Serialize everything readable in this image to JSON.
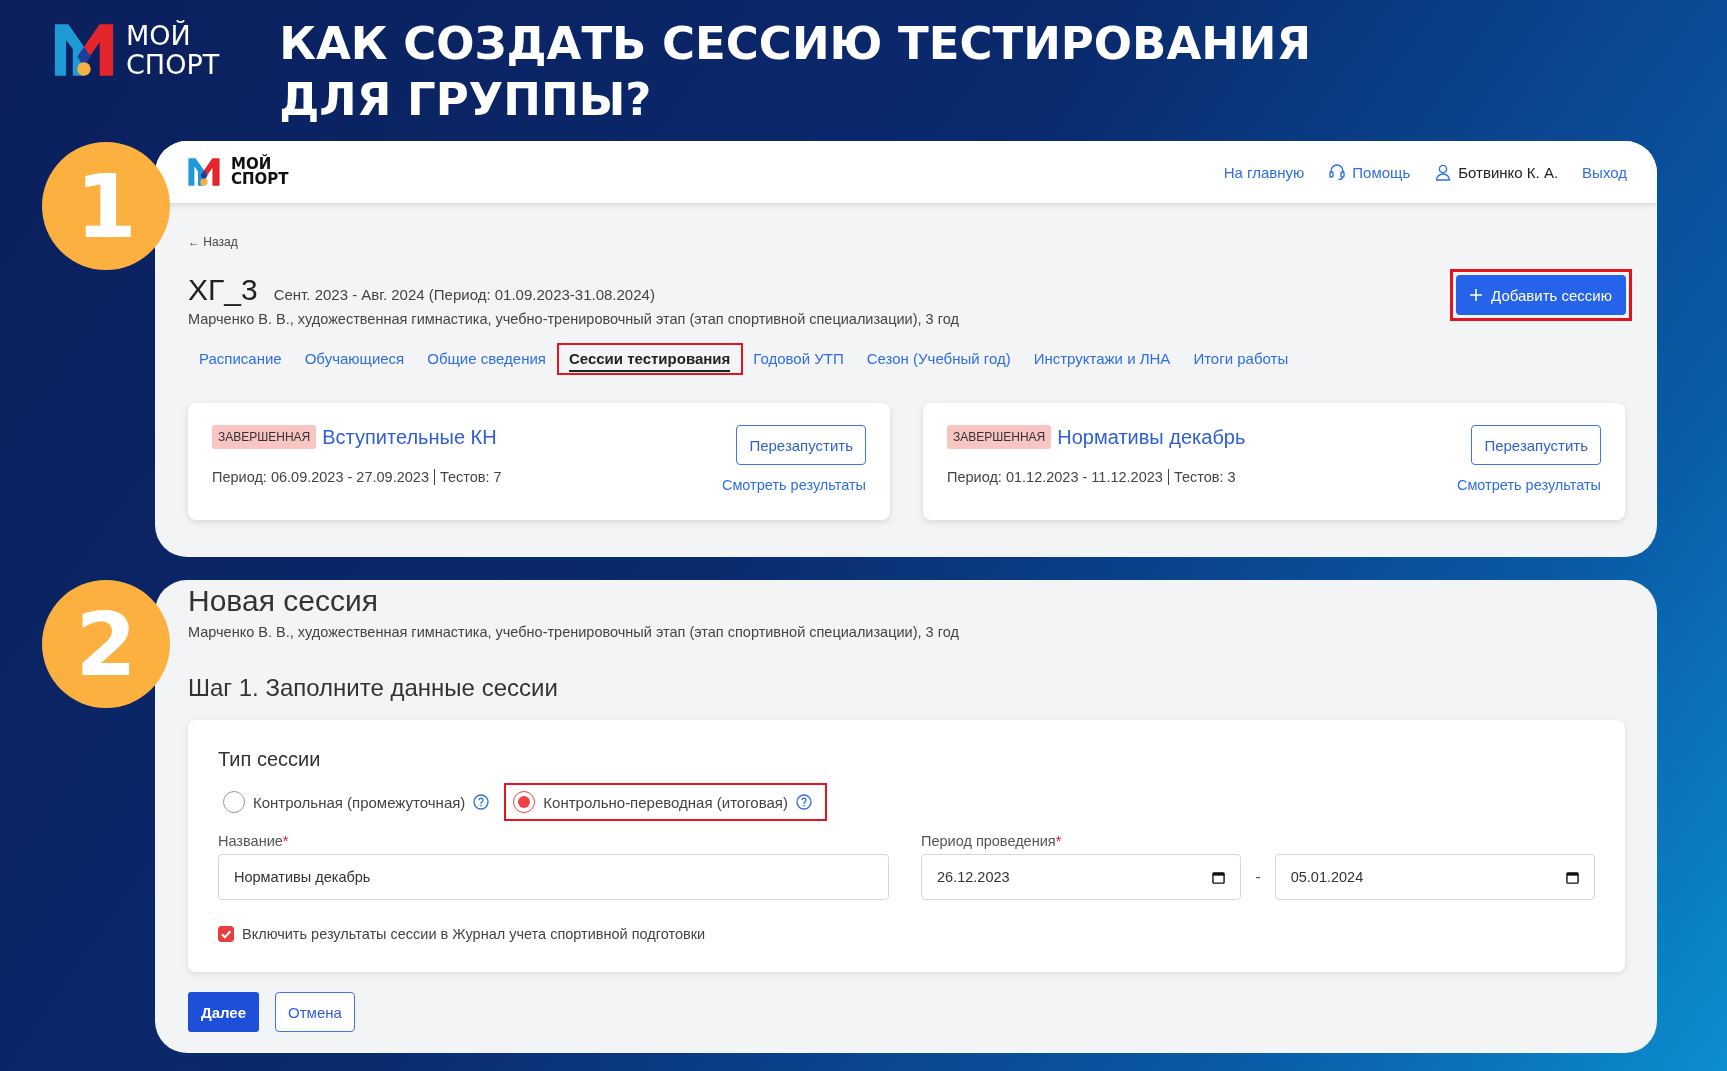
{
  "brand": {
    "line1": "МОЙ",
    "line2": "СПОРТ"
  },
  "headline": [
    "КАК СОЗДАТЬ СЕССИЮ ТЕСТИРОВАНИЯ",
    "ДЛЯ ГРУППЫ?"
  ],
  "step_1": {
    "number": "1",
    "app_brand": {
      "line1": "МОЙ",
      "line2": "СПОРТ"
    },
    "nav": [
      {
        "label": "На главную",
        "kind": "link"
      },
      {
        "label": "Помощь",
        "kind": "help"
      },
      {
        "label": "Ботвинко К. А.",
        "kind": "user"
      },
      {
        "label": "Выход",
        "kind": "link"
      }
    ],
    "back_link": "← Назад",
    "group": {
      "title": "ХГ_3",
      "period": "Сент. 2023 - Авг. 2024 (Период: 01.09.2023-31.08.2024)",
      "coach": "Марченко В. В., художественная гимнастика, учебно-тренировочный этап (этап спортивной специализации), 3 год"
    },
    "add_button": {
      "label": "Добавить сессию",
      "highlighted": true
    },
    "tabs": [
      {
        "label": "Расписание",
        "selected": false,
        "highlighted": false
      },
      {
        "label": "Обучающиеся",
        "selected": false,
        "highlighted": false
      },
      {
        "label": "Общие сведения",
        "selected": false,
        "highlighted": false
      },
      {
        "label": "Сессии тестирования",
        "selected": true,
        "highlighted": true
      },
      {
        "label": "Годовой УТП",
        "selected": false,
        "highlighted": false
      },
      {
        "label": "Сезон (Учебный год)",
        "selected": false,
        "highlighted": false
      },
      {
        "label": "Инструктажи и ЛНА",
        "selected": false,
        "highlighted": false
      },
      {
        "label": "Итоги работы",
        "selected": false,
        "highlighted": false
      }
    ],
    "sessions": [
      {
        "status": "ЗАВЕРШЕННАЯ",
        "name": "Вступительные КН",
        "period": "Период: 06.09.2023 - 27.09.2023",
        "tests": "Тестов: 7",
        "restart": "Перезапустить",
        "results": "Смотреть результаты"
      },
      {
        "status": "ЗАВЕРШЕННАЯ",
        "name": "Нормативы декабрь",
        "period": "Период: 01.12.2023 - 11.12.2023",
        "tests": "Тестов: 3",
        "restart": "Перезапустить",
        "results": "Смотреть результаты"
      }
    ]
  },
  "step_2": {
    "number": "2",
    "title": "Новая сессия",
    "coach": "Марченко В. В., художественная гимнастика, учебно-тренировочный этап (этап спортивной специализации), 3 год",
    "step_title": "Шаг 1. Заполните данные сессии",
    "form": {
      "section_title": "Тип сессии",
      "session_types": [
        {
          "label": "Контрольная (промежуточная)",
          "selected": false,
          "highlighted": false
        },
        {
          "label": "Контрольно-переводная (итоговая)",
          "selected": true,
          "highlighted": true
        }
      ],
      "name_field": {
        "label": "Название",
        "required_mark": "*",
        "value": "Нормативы декабрь"
      },
      "period_field": {
        "label": "Период проведения",
        "required_mark": "*",
        "from": "26.12.2023",
        "separator": "-",
        "to": "05.01.2024"
      },
      "include_journal": {
        "label": "Включить результаты сессии в Журнал учета спортивной подготовки",
        "checked": true
      }
    },
    "buttons": [
      {
        "label": "Далее",
        "kind": "primary"
      },
      {
        "label": "Отмена",
        "kind": "secondary"
      }
    ]
  }
}
